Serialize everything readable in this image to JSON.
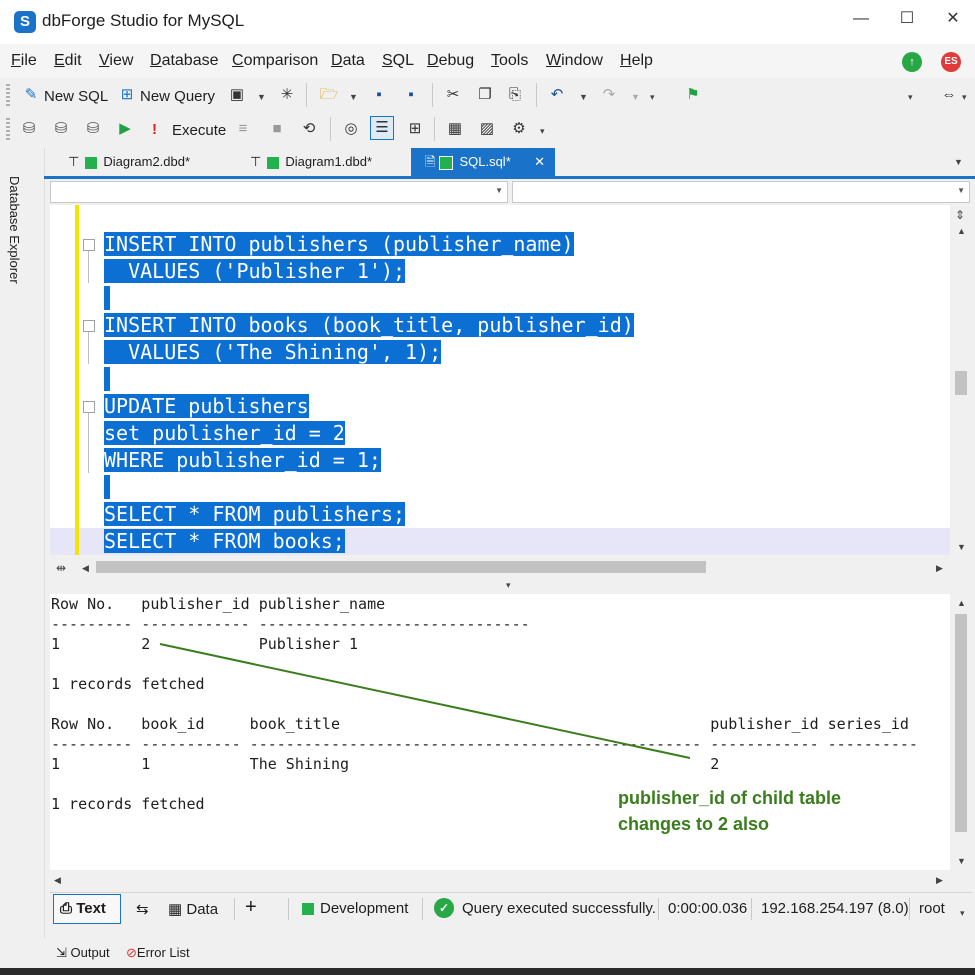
{
  "window": {
    "title": "dbForge Studio for MySQL",
    "logo_letter": "S",
    "minimize": "—",
    "maximize": "☐",
    "close": "✕"
  },
  "menu": {
    "items": [
      {
        "label": "File",
        "ul": "F",
        "rest": "ile"
      },
      {
        "label": "Edit",
        "ul": "E",
        "rest": "dit"
      },
      {
        "label": "View",
        "ul": "V",
        "rest": "iew"
      },
      {
        "label": "Database",
        "ul": "D",
        "rest": "atabase"
      },
      {
        "label": "Comparison",
        "ul": "C",
        "rest": "omparison"
      },
      {
        "label": "Data",
        "ul": "D",
        "rest": "ata"
      },
      {
        "label": "SQL",
        "ul": "S",
        "rest": "QL"
      },
      {
        "label": "Debug",
        "ul": "D",
        "rest": "ebug"
      },
      {
        "label": "Tools",
        "ul": "T",
        "rest": "ools"
      },
      {
        "label": "Window",
        "ul": "W",
        "rest": "indow"
      },
      {
        "label": "Help",
        "ul": "H",
        "rest": "elp"
      }
    ],
    "user_initials": "ES",
    "update_icon": "↑"
  },
  "toolbar1": {
    "new_sql": "New SQL",
    "new_query": "New Query"
  },
  "toolbar2": {
    "execute": "Execute",
    "execute_mark": "!"
  },
  "side_panel": {
    "label": "Database Explorer"
  },
  "tabs": [
    {
      "label": "Diagram2.dbd*",
      "active": false
    },
    {
      "label": "Diagram1.dbd*",
      "active": false
    },
    {
      "label": "SQL.sql*",
      "active": true
    }
  ],
  "tab_close": "✕",
  "editor": {
    "lines": [
      "INSERT INTO publishers (publisher_name)",
      "  VALUES ('Publisher 1');",
      "",
      "INSERT INTO books (book_title, publisher_id)",
      "  VALUES ('The Shining', 1);",
      "",
      "UPDATE publishers",
      "set publisher_id = 2",
      "WHERE publisher_id = 1;",
      "",
      "SELECT * FROM publishers;",
      "SELECT * FROM books;"
    ],
    "selection_color": "#0b6fd3"
  },
  "results": {
    "lines": [
      "Row No.   publisher_id publisher_name",
      "--------- ------------ ------------------------------",
      "1         2            Publisher 1",
      "",
      "1 records fetched",
      "",
      "Row No.   book_id     book_title                                         publisher_id series_id",
      "--------- ----------- -------------------------------------------------- ------------ ----------",
      "1         1           The Shining                                        2",
      "",
      "1 records fetched"
    ]
  },
  "annotation": {
    "line1": "publisher_id of child table",
    "line2": "changes to 2 also",
    "color": "#3a7d1c"
  },
  "statusbar": {
    "text_tab": "Text",
    "data_tab": "Data",
    "add": "+",
    "environment": "Development",
    "message": "Query executed successfully.",
    "elapsed": "0:00:00.036",
    "server": "192.168.254.197 (8.0)",
    "user": "root"
  },
  "bottom": {
    "output": "Output",
    "error_list": "Error List"
  }
}
